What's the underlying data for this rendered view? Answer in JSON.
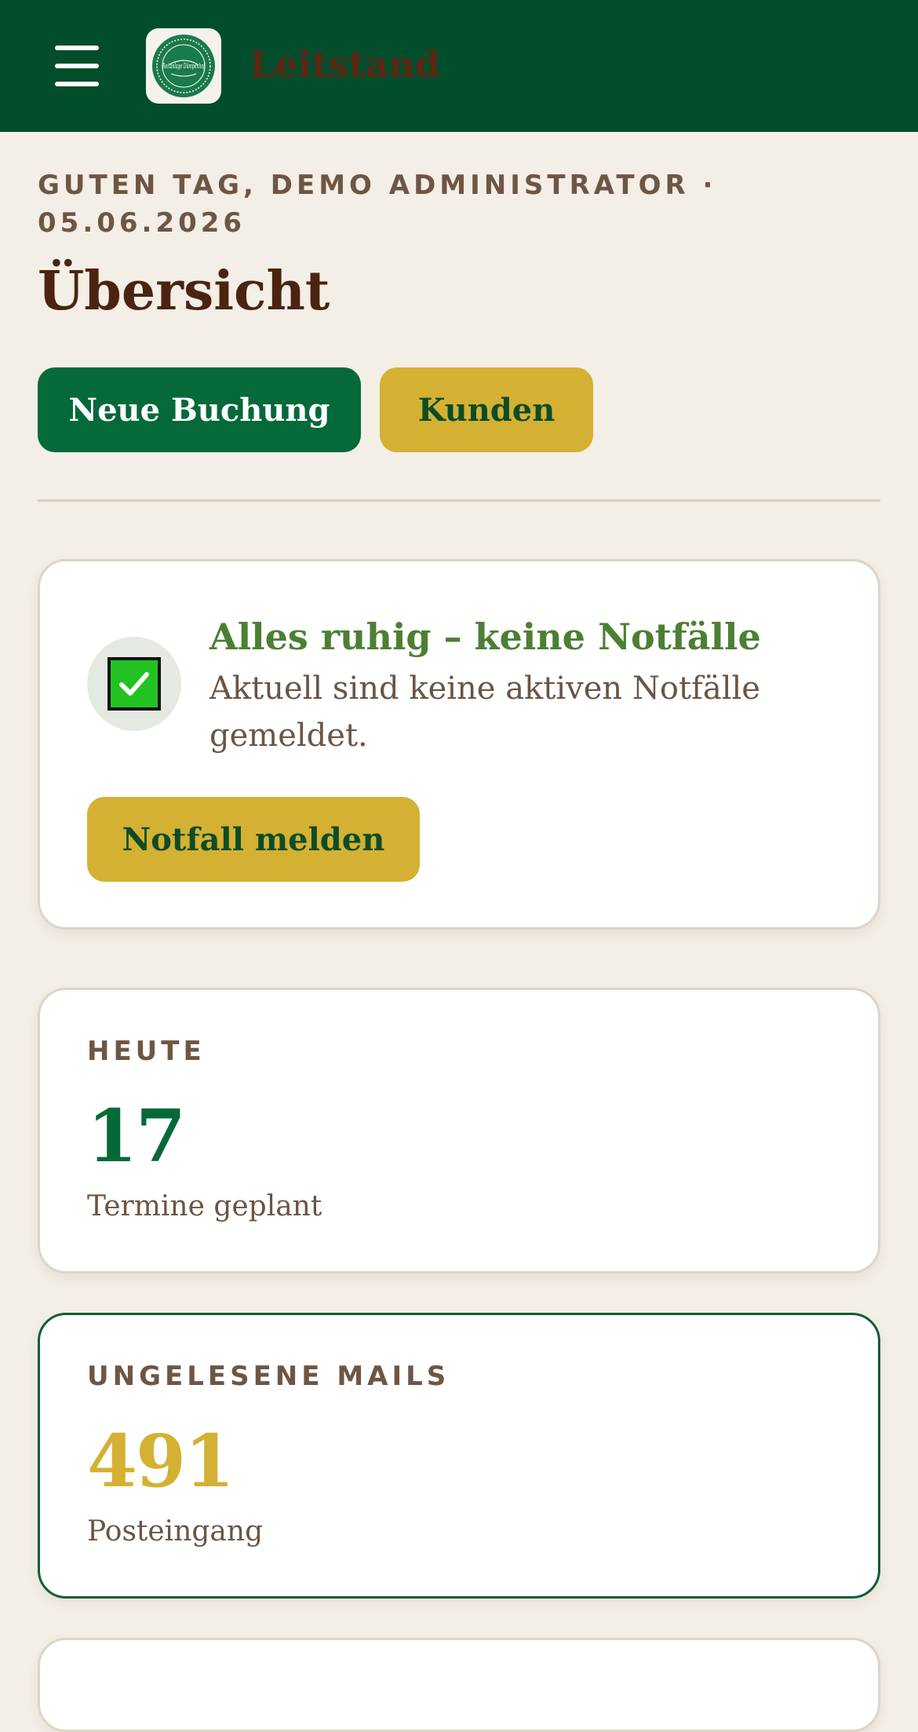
{
  "header": {
    "menu_icon": "hamburger-menu-icon",
    "logo_icon": "reitanlage-logo",
    "logo_text": "Reitanlage Dümpenhof",
    "title": "Leitstand",
    "background": "#024d2c"
  },
  "greeting": {
    "text": "GUTEN TAG, DEMO ADMINISTRATOR · 05.06.2026"
  },
  "page_title": "Übersicht",
  "actions": {
    "new_booking_label": "Neue Buchung",
    "customers_label": "Kunden"
  },
  "emergency_card": {
    "status_icon": "checkmark-icon",
    "title": "Alles ruhig – keine Notfälle",
    "text": "Aktuell sind keine aktiven Notfälle gemeldet.",
    "button_label": "Notfall melden"
  },
  "stats": [
    {
      "label": "HEUTE",
      "value": "17",
      "sub": "Termine geplant",
      "color": "#05693a"
    },
    {
      "label": "UNGELESENE MAILS",
      "value": "491",
      "sub": "Posteingang",
      "color": "#d4b133"
    }
  ],
  "colors": {
    "brand_green": "#05693a",
    "dark_green": "#024d2c",
    "gold": "#d4b133",
    "background": "#f3eee6",
    "heading_brown": "#4a2411"
  }
}
